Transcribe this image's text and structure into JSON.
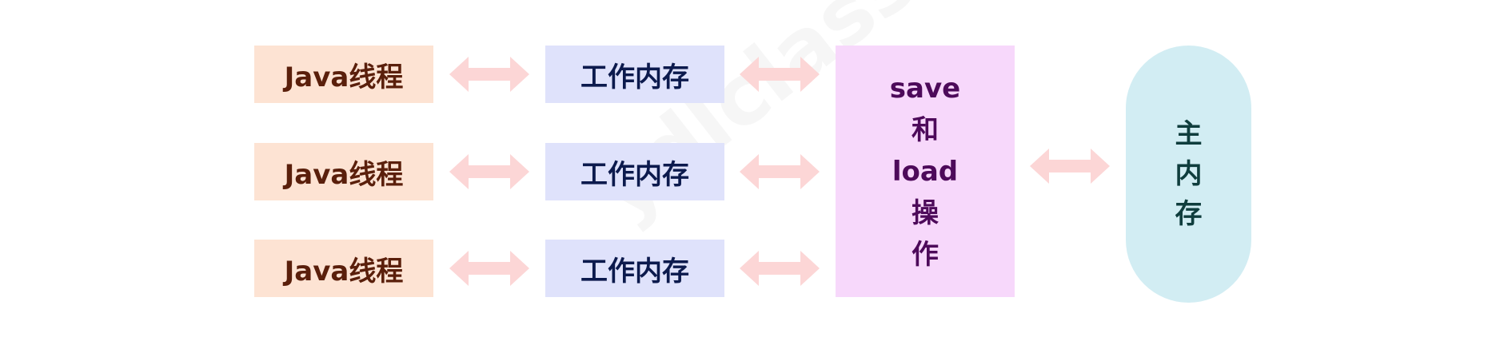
{
  "threads": [
    {
      "label": "Java线程"
    },
    {
      "label": "Java线程"
    },
    {
      "label": "Java线程"
    }
  ],
  "work_memory": [
    {
      "label": "工作内存"
    },
    {
      "label": "工作内存"
    },
    {
      "label": "工作内存"
    }
  ],
  "save_load": {
    "lines": [
      "save",
      "和",
      "load",
      "操",
      "作"
    ]
  },
  "main_memory": {
    "lines": [
      "主",
      "内",
      "存"
    ]
  },
  "watermark": "ydlclass.com",
  "colors": {
    "thread_bg": "#fde3d3",
    "work_memory_bg": "#dfe2fb",
    "save_load_bg": "#f7d8fb",
    "main_memory_bg": "#d2edf3",
    "arrow": "#fcd6d6"
  }
}
